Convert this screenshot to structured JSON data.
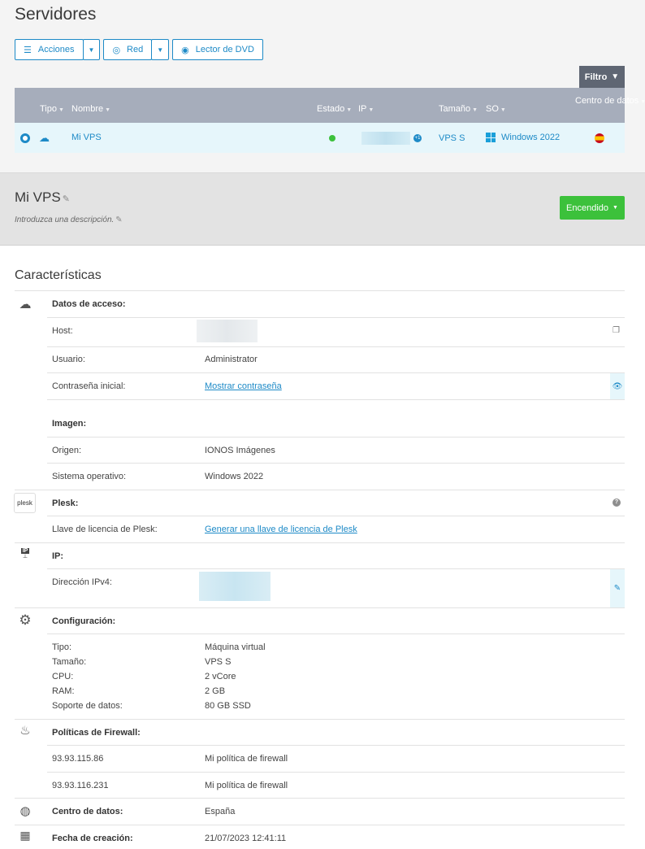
{
  "header": {
    "title": "Servidores"
  },
  "toolbar": {
    "acciones": "Acciones",
    "red": "Red",
    "lector": "Lector de DVD",
    "filtro": "Filtro"
  },
  "table": {
    "columns": [
      "Tipo",
      "Nombre",
      "Estado",
      "IP",
      "Tamaño",
      "SO",
      "Centro de datos"
    ],
    "row": {
      "name": "Mi VPS",
      "ip_badge": "+1",
      "size": "VPS S",
      "os": "Windows 2022"
    }
  },
  "detail": {
    "title": "Mi VPS",
    "description": "Introduzca una descripción.",
    "power_button": "Encendido"
  },
  "features": {
    "title": "Características",
    "access": {
      "heading": "Datos de acceso:",
      "host_label": "Host:",
      "user_label": "Usuario:",
      "user_value": "Administrator",
      "password_label": "Contraseña inicial:",
      "password_link": "Mostrar contraseña"
    },
    "image": {
      "heading": "Imagen:",
      "origin_label": "Origen:",
      "origin_value": "IONOS Imágenes",
      "os_label": "Sistema operativo:",
      "os_value": "Windows 2022"
    },
    "plesk": {
      "logo": "plesk",
      "heading": "Plesk:",
      "license_label": "Llave de licencia de Plesk:",
      "license_link": "Generar una llave de licencia de Plesk"
    },
    "ip": {
      "logo": "IP",
      "heading": "IP:",
      "ipv4_label": "Dirección IPv4:"
    },
    "config": {
      "heading": "Configuración:",
      "rows": [
        {
          "label": "Tipo:",
          "value": "Máquina virtual"
        },
        {
          "label": "Tamaño:",
          "value": "VPS S"
        },
        {
          "label": "CPU:",
          "value": "2 vCore"
        },
        {
          "label": "RAM:",
          "value": "2 GB"
        },
        {
          "label": "Soporte de datos:",
          "value": "80 GB SSD"
        }
      ]
    },
    "firewall": {
      "heading": "Políticas de Firewall:",
      "rows": [
        {
          "ip": "93.93.115.86",
          "policy": "Mi política de firewall"
        },
        {
          "ip": "93.93.116.231",
          "policy": "Mi política de firewall"
        }
      ]
    },
    "datacenter": {
      "label": "Centro de datos:",
      "value": "España"
    },
    "created": {
      "label": "Fecha de creación:",
      "value": "21/07/2023 12:41:11"
    }
  }
}
